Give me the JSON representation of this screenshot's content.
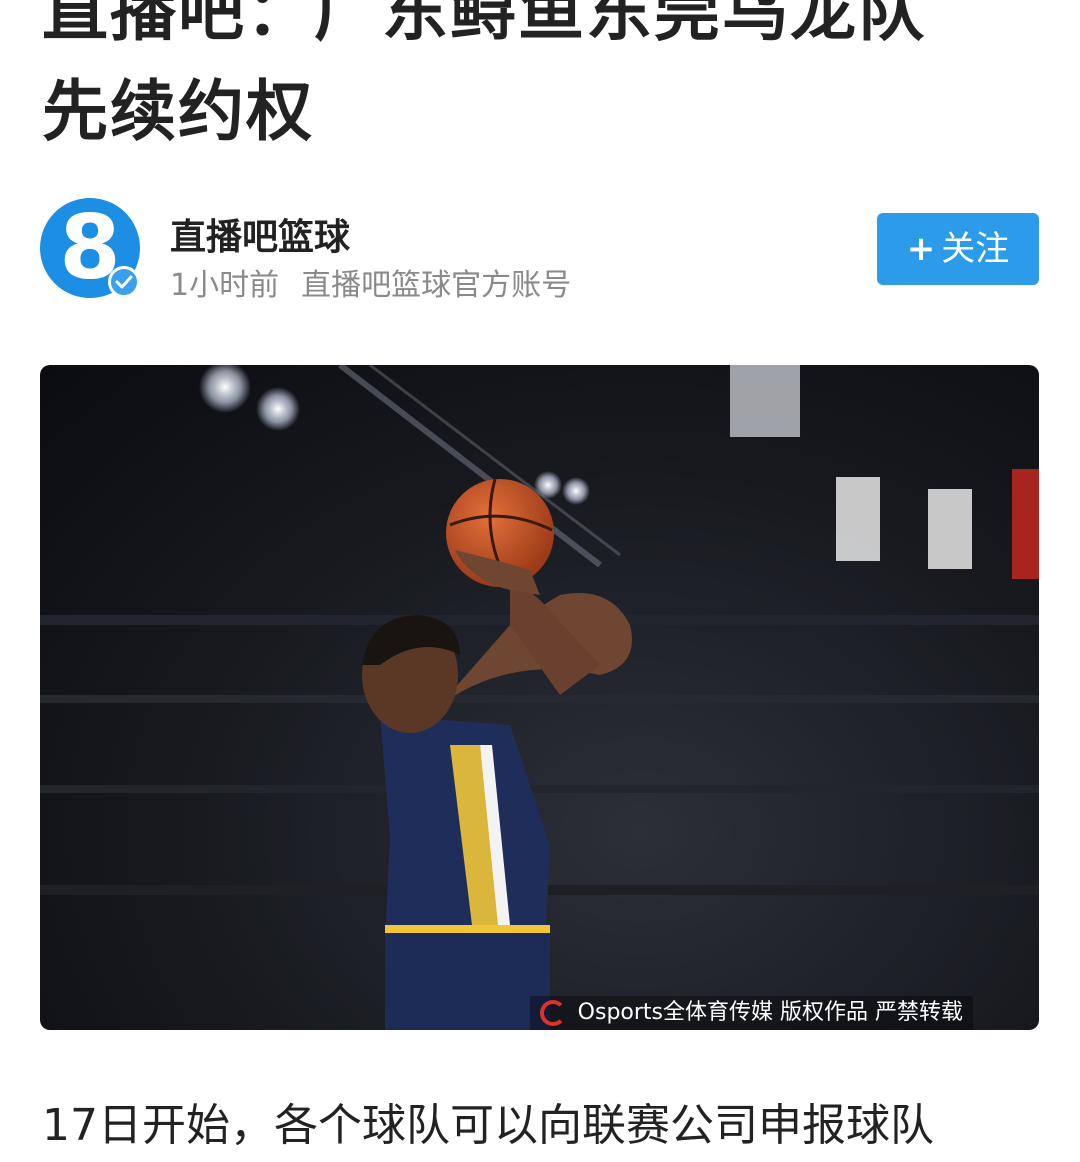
{
  "article": {
    "title_line1": "直播吧：广东鲟鱼东莞乌龙队",
    "title_line2": "先续约权"
  },
  "author": {
    "avatar_glyph": "8",
    "name": "直播吧篮球",
    "time": "1小时前",
    "description": "直播吧篮球官方账号"
  },
  "follow_button": {
    "plus": "+",
    "label": "关注"
  },
  "photo": {
    "watermark": "Osports全体育传媒 版权作品 严禁转载"
  },
  "body": {
    "first_line": "17日开始，各个球队可以向联赛公司申报球队"
  },
  "colors": {
    "accent": "#2b9bea",
    "avatar_bg": "#1c8fe5",
    "meta_text": "#8a8a8a"
  }
}
